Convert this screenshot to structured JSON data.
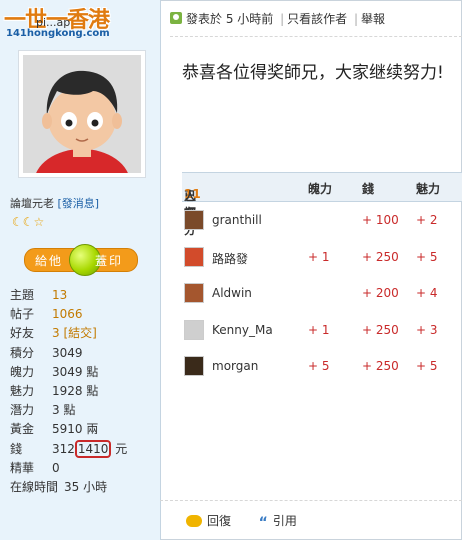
{
  "site": {
    "logo_top": "一世一香港",
    "logo_bottom": "141hongkong.com"
  },
  "poster": {
    "username": "pi...ap",
    "rank": "論壇元老",
    "message_link": "[發消息]",
    "stars": "☾☾☆",
    "give_label": "給他",
    "stamp_label": "蓋印"
  },
  "stats": [
    {
      "key": "主題",
      "value": "13"
    },
    {
      "key": "帖子",
      "value": "1066"
    },
    {
      "key": "好友",
      "value": "3",
      "extra": "[結交]"
    },
    {
      "key": "積分",
      "value": "3049"
    },
    {
      "key": "魄力",
      "value": "3049 點"
    },
    {
      "key": "魅力",
      "value": "1928 點"
    },
    {
      "key": "潛力",
      "value": "3 點"
    },
    {
      "key": "黃金",
      "value": "5910 兩"
    },
    {
      "key": "錢",
      "value_prefix": "312",
      "value_circled": "1410",
      "value_suffix": " 元"
    },
    {
      "key": "精華",
      "value": "0"
    },
    {
      "key": "在線時間",
      "value": "35 小時"
    }
  ],
  "post_header": {
    "posted": "發表於 5 小時前",
    "only_author": "只看該作者",
    "report": "舉報"
  },
  "post": {
    "content": "恭喜各位得奖師兄，大家继续努力!"
  },
  "ratings": {
    "header_prefix": "已有 ",
    "count": "11",
    "header_suffix": " 人評分",
    "col1": "魄力",
    "col2": "錢",
    "col3": "魅力",
    "rows": [
      {
        "name": "granthill",
        "c1": "",
        "c2": "+ 100",
        "c3": "+ 2",
        "avatar": "#7a4a2a"
      },
      {
        "name": "路路發",
        "c1": "+ 1",
        "c2": "+ 250",
        "c3": "+ 5",
        "avatar": "#d24b2b"
      },
      {
        "name": "Aldwin",
        "c1": "",
        "c2": "+ 200",
        "c3": "+ 4",
        "avatar": "#a4562e"
      },
      {
        "name": "Kenny_Ma",
        "c1": "+ 1",
        "c2": "+ 250",
        "c3": "+ 3",
        "avatar": "#cfcfcf"
      },
      {
        "name": "morgan",
        "c1": "+ 5",
        "c2": "+ 250",
        "c3": "+ 5",
        "avatar": "#3a2a1a"
      }
    ]
  },
  "footer": {
    "reply": "回復",
    "quote_icon": "“",
    "quote": "引用"
  },
  "colors": {
    "accent_orange": "#e07b10",
    "rating_red": "#c92a2a",
    "link_blue": "#1b5fa6"
  }
}
